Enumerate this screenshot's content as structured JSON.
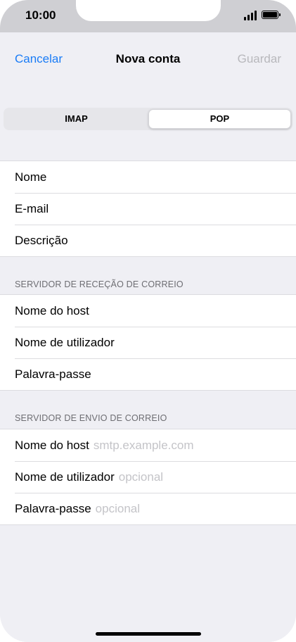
{
  "status_bar": {
    "time": "10:00"
  },
  "nav": {
    "cancel": "Cancelar",
    "title": "Nova conta",
    "save": "Guardar"
  },
  "segmented": {
    "left": "IMAP",
    "right": "POP",
    "selected": "POP"
  },
  "account": {
    "rows": [
      {
        "label": "Nome"
      },
      {
        "label": "E-mail"
      },
      {
        "label": "Descrição"
      }
    ]
  },
  "incoming": {
    "header": "SERVIDOR DE RECEÇÃO DE CORREIO",
    "rows": [
      {
        "label": "Nome do host"
      },
      {
        "label": "Nome de utilizador"
      },
      {
        "label": "Palavra-passe"
      }
    ]
  },
  "outgoing": {
    "header": "SERVIDOR DE ENVIO DE CORREIO",
    "rows": [
      {
        "label": "Nome do host",
        "placeholder": "smtp.example.com"
      },
      {
        "label": "Nome de utilizador",
        "placeholder": "opcional"
      },
      {
        "label": "Palavra-passe",
        "placeholder": "opcional"
      }
    ]
  },
  "colors": {
    "accent": "#1a7cf6",
    "disabled": "#b8b8bc",
    "background": "#efeff4",
    "placeholder": "#c4c4c8"
  },
  "icons": [
    "signal-icon",
    "battery-icon"
  ]
}
